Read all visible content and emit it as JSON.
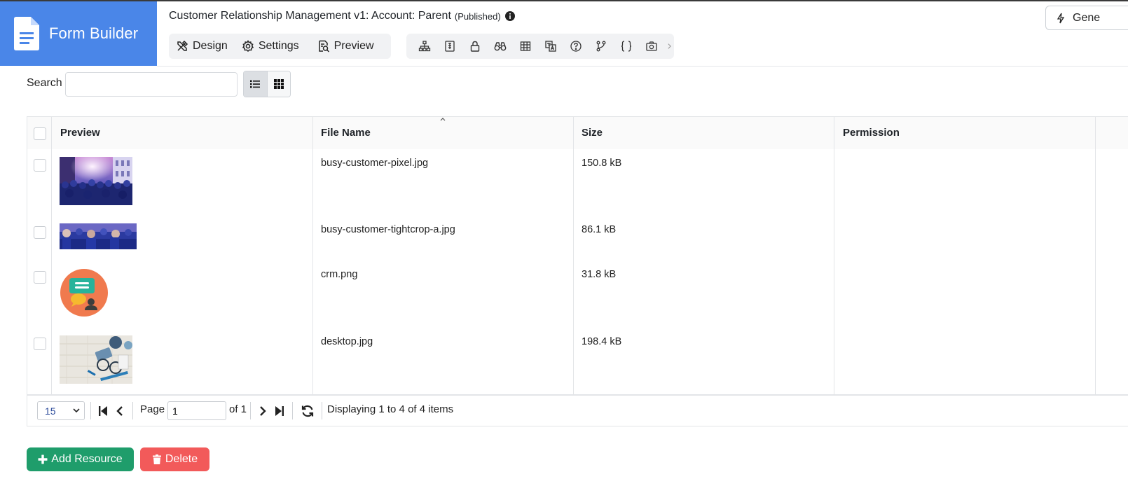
{
  "app": {
    "brand": "Form Builder",
    "page_title": "Customer Relationship Management v1: Account: Parent",
    "status": "(Published)"
  },
  "tabs": [
    {
      "label": "Design",
      "icon": "tools-icon"
    },
    {
      "label": "Settings",
      "icon": "gear-icon"
    },
    {
      "label": "Preview",
      "icon": "preview-icon"
    }
  ],
  "toolbar_icons": [
    "hierarchy-icon",
    "code-list-icon",
    "lock-icon",
    "binoculars-icon",
    "table-icon",
    "translate-icon",
    "help-icon",
    "branch-icon",
    "braces-icon",
    "camera-icon"
  ],
  "generate_button": "Gene",
  "search": {
    "label": "Search",
    "value": "",
    "placeholder": ""
  },
  "grid": {
    "columns": [
      "Preview",
      "File Name",
      "Size",
      "Permission"
    ],
    "rows": [
      {
        "file": "busy-customer-pixel.jpg",
        "size": "150.8 kB",
        "permission": ""
      },
      {
        "file": "busy-customer-tightcrop-a.jpg",
        "size": "86.1 kB",
        "permission": ""
      },
      {
        "file": "crm.png",
        "size": "31.8 kB",
        "permission": ""
      },
      {
        "file": "desktop.jpg",
        "size": "198.4 kB",
        "permission": ""
      }
    ]
  },
  "pager": {
    "page_size": "15",
    "page_label": "Page",
    "page_value": "1",
    "of_label": "of 1",
    "display_text": "Displaying 1 to 4 of 4 items"
  },
  "actions": {
    "add": "Add Resource",
    "delete": "Delete"
  },
  "colors": {
    "brand": "#4a86e8",
    "add": "#1f9d6b",
    "delete": "#f25a5a"
  }
}
